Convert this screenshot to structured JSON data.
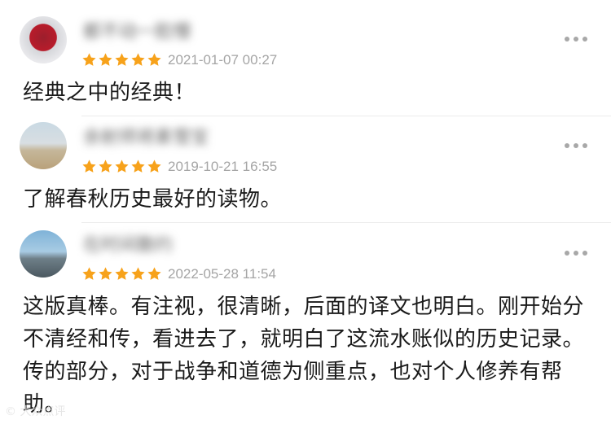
{
  "reviews": [
    {
      "username": "都不动一脸懵",
      "rating": 5,
      "timestamp": "2021-01-07 00:27",
      "content": "经典之中的经典！",
      "more_icon": "more-dots-icon"
    },
    {
      "username": "余射师将素雪宝",
      "rating": 5,
      "timestamp": "2019-10-21 16:55",
      "content": "了解春秋历史最好的读物。",
      "more_icon": "more-dots-icon"
    },
    {
      "username": "在时间散约",
      "rating": 5,
      "timestamp": "2022-05-28 11:54",
      "content": "这版真棒。有注视，很清晰，后面的译文也明白。刚开始分不清经和传，看进去了，就明白了这流水账似的历史记录。传的部分，对于战争和道德为侧重点，也对个人修养有帮助。",
      "more_icon": "more-dots-icon"
    }
  ],
  "star_color": "#f7a21b",
  "watermark": "© 大众点评"
}
